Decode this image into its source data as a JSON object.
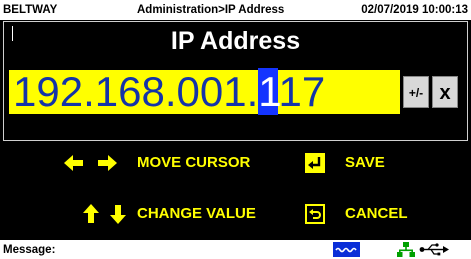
{
  "status_bar": {
    "device": "BELTWAY",
    "path": "Administration>IP Address",
    "datetime": "02/07/2019 10:00:13"
  },
  "panel": {
    "title": "IP Address",
    "ip_before_cursor": "192.168.001.",
    "ip_cursor_char": "1",
    "ip_after_cursor": "17",
    "sign_key_label": "+/-",
    "clear_key_label": "x"
  },
  "help": {
    "move_cursor": "MOVE CURSOR",
    "change_value": "CHANGE VALUE",
    "save": "SAVE",
    "cancel": "CANCEL"
  },
  "message_bar": {
    "label": "Message:"
  },
  "colors": {
    "ip_background": "#ffff00",
    "ip_text": "#1434a8",
    "cursor": "#1434ff",
    "help_text": "#ffff00",
    "net_icon": "#00a000",
    "wave_icon_bg": "#0a2ed8"
  },
  "icons": {
    "left": "arrow-left-icon",
    "right": "arrow-right-icon",
    "up": "arrow-up-icon",
    "down": "arrow-down-icon",
    "enter": "enter-key-icon",
    "cancel": "return-icon",
    "wave": "wave-icon",
    "network": "network-icon",
    "usb": "usb-icon"
  }
}
